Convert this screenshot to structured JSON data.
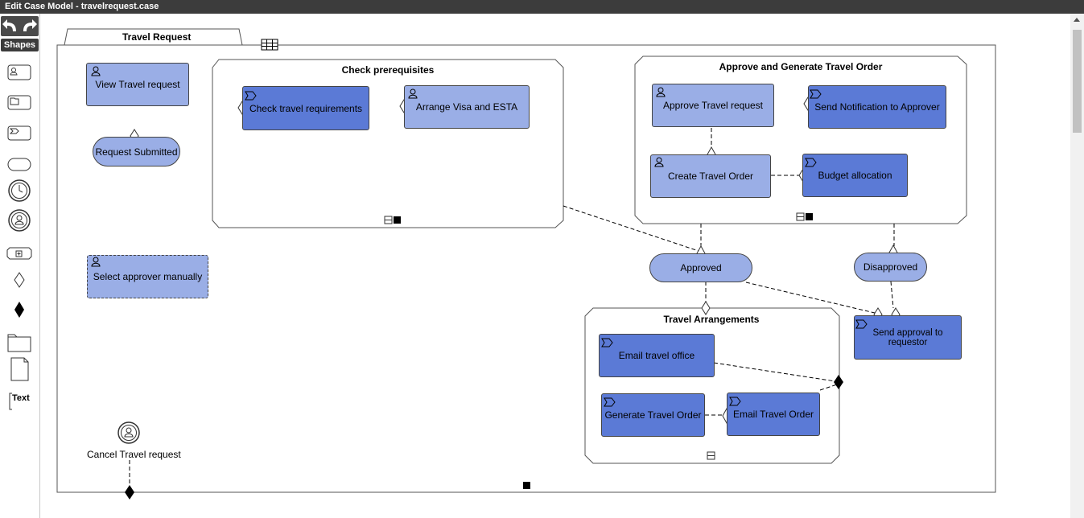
{
  "window": {
    "title": "Edit Case Model - travelrequest.case"
  },
  "palette": {
    "header": "Shapes",
    "items": [
      {
        "name": "human-task-icon"
      },
      {
        "name": "case-task-icon"
      },
      {
        "name": "process-task-icon"
      },
      {
        "name": "milestone-icon"
      },
      {
        "name": "timer-event-icon"
      },
      {
        "name": "user-event-icon"
      },
      {
        "name": "stage-icon"
      },
      {
        "name": "entry-criterion-icon"
      },
      {
        "name": "exit-criterion-icon"
      },
      {
        "name": "case-file-item-icon"
      },
      {
        "name": "document-icon"
      },
      {
        "name": "text-annotation-icon",
        "label": "Text"
      }
    ]
  },
  "case_plan": {
    "name": "Travel Request"
  },
  "stages": {
    "check_prerequisites": {
      "title": "Check prerequisites"
    },
    "approve_generate": {
      "title": "Approve and Generate Travel Order"
    },
    "travel_arrangements": {
      "title": "Travel Arrangements"
    }
  },
  "tasks": {
    "view_travel_request": "View Travel request",
    "check_travel_requirements": "Check travel requirements",
    "arrange_visa": "Arrange Visa and ESTA",
    "approve_travel_request": "Approve Travel request",
    "send_notification": "Send Notification to Approver",
    "create_travel_order": "Create Travel Order",
    "budget_allocation": "Budget allocation",
    "select_approver": "Select approver manually",
    "email_travel_office": "Email travel office",
    "generate_travel_order": "Generate Travel Order",
    "email_travel_order": "Email Travel Order",
    "send_approval": "Send approval to requestor"
  },
  "milestones": {
    "request_submitted": "Request Submitted",
    "approved": "Approved",
    "disapproved": "Disapproved"
  },
  "events": {
    "cancel_travel_request": "Cancel Travel request"
  }
}
